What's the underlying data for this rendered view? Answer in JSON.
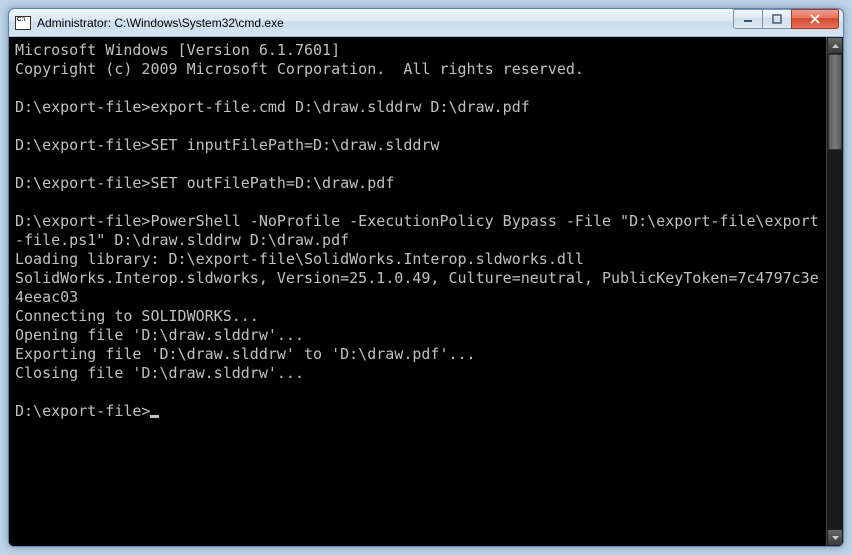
{
  "window": {
    "icon_label": "C:\\",
    "title": "Administrator: C:\\Windows\\System32\\cmd.exe"
  },
  "controls": {
    "minimize": "minimize",
    "maximize": "maximize",
    "close": "close"
  },
  "terminal": {
    "lines": [
      "Microsoft Windows [Version 6.1.7601]",
      "Copyright (c) 2009 Microsoft Corporation.  All rights reserved.",
      "",
      "D:\\export-file>export-file.cmd D:\\draw.slddrw D:\\draw.pdf",
      "",
      "D:\\export-file>SET inputFilePath=D:\\draw.slddrw",
      "",
      "D:\\export-file>SET outFilePath=D:\\draw.pdf",
      "",
      "D:\\export-file>PowerShell -NoProfile -ExecutionPolicy Bypass -File \"D:\\export-file\\export-file.ps1\" D:\\draw.slddrw D:\\draw.pdf",
      "Loading library: D:\\export-file\\SolidWorks.Interop.sldworks.dll",
      "SolidWorks.Interop.sldworks, Version=25.1.0.49, Culture=neutral, PublicKeyToken=7c4797c3e4eeac03",
      "Connecting to SOLIDWORKS...",
      "Opening file 'D:\\draw.slddrw'...",
      "Exporting file 'D:\\draw.slddrw' to 'D:\\draw.pdf'...",
      "Closing file 'D:\\draw.slddrw'...",
      "",
      "D:\\export-file>"
    ]
  }
}
